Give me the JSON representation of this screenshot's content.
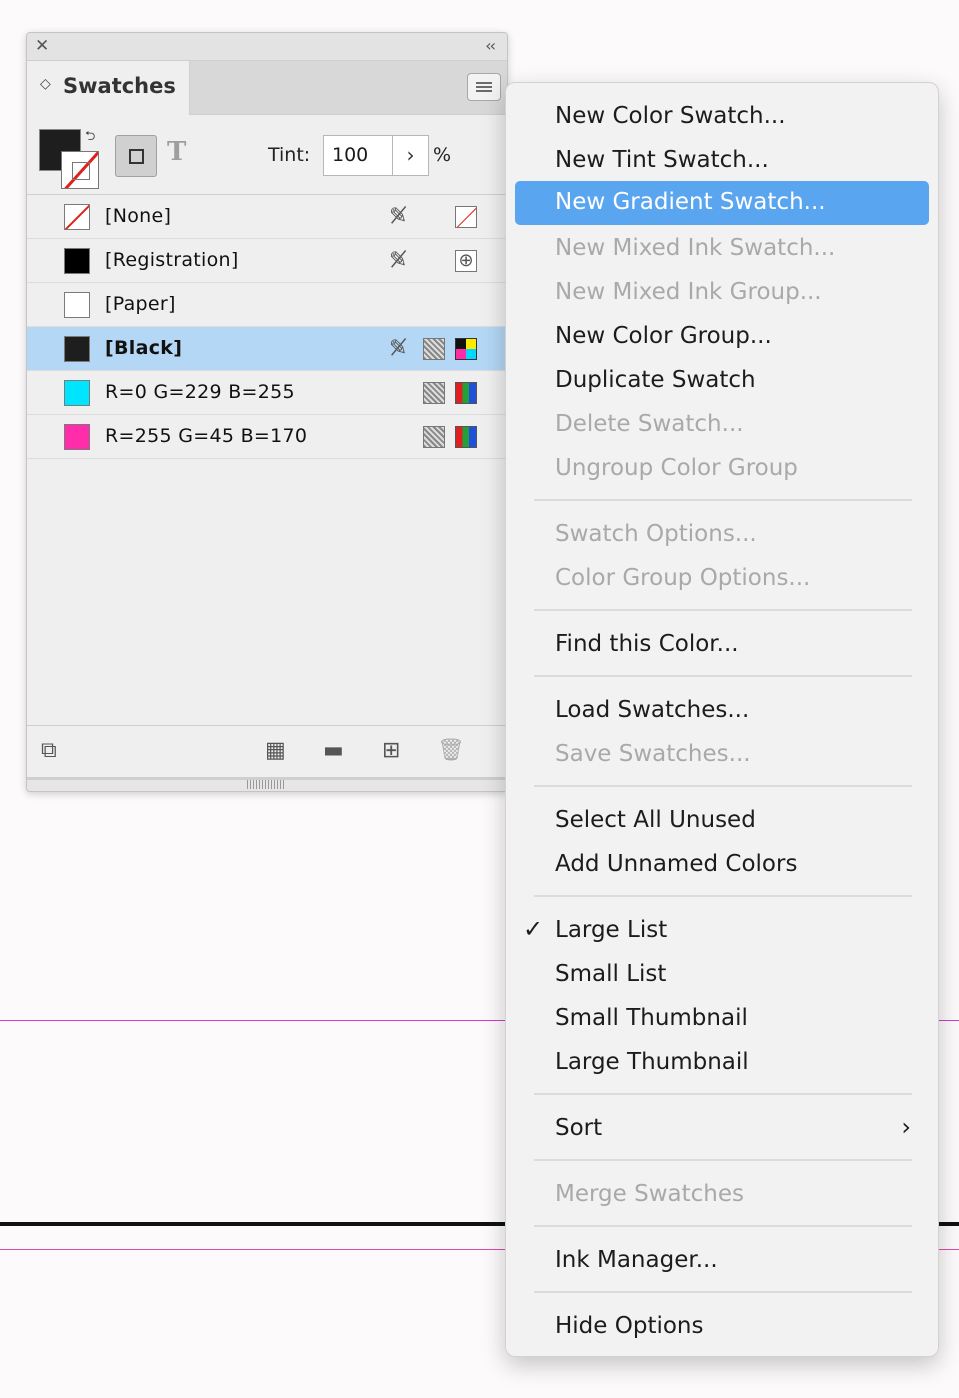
{
  "panel": {
    "title": "Swatches",
    "tint_label": "Tint:",
    "tint_value": "100",
    "tint_unit": "%",
    "swatches": [
      {
        "name": "[None]",
        "color": "none",
        "selected": false
      },
      {
        "name": "[Registration]",
        "color": "#000000",
        "selected": false
      },
      {
        "name": "[Paper]",
        "color": "#ffffff",
        "selected": false
      },
      {
        "name": "[Black]",
        "color": "#1e1e1e",
        "selected": true
      },
      {
        "name": "R=0 G=229 B=255",
        "color": "#00e5ff",
        "selected": false
      },
      {
        "name": "R=255 G=45 B=170",
        "color": "#ff2daa",
        "selected": false
      }
    ],
    "icons": {
      "close": "close-icon",
      "collapse": "collapse-icon",
      "panel_menu": "hamburger-icon",
      "bottom": [
        "import-icon",
        "show-kinds-icon",
        "folder-icon",
        "new-swatch-icon",
        "trash-icon"
      ]
    }
  },
  "menu": {
    "items": [
      {
        "label": "New Color Swatch...",
        "enabled": true
      },
      {
        "label": "New Tint Swatch...",
        "enabled": true
      },
      {
        "label": "New Gradient Swatch...",
        "enabled": true,
        "highlighted": true
      },
      {
        "label": "New Mixed Ink Swatch...",
        "enabled": false
      },
      {
        "label": "New Mixed Ink Group...",
        "enabled": false
      },
      {
        "label": "New Color Group...",
        "enabled": true
      },
      {
        "label": "Duplicate Swatch",
        "enabled": true
      },
      {
        "label": "Delete Swatch...",
        "enabled": false
      },
      {
        "label": "Ungroup Color Group",
        "enabled": false
      },
      {
        "label": "Swatch Options...",
        "enabled": false
      },
      {
        "label": "Color Group Options...",
        "enabled": false
      },
      {
        "label": "Find this Color...",
        "enabled": true
      },
      {
        "label": "Load Swatches...",
        "enabled": true
      },
      {
        "label": "Save Swatches...",
        "enabled": false
      },
      {
        "label": "Select All Unused",
        "enabled": true
      },
      {
        "label": "Add Unnamed Colors",
        "enabled": true
      },
      {
        "label": "Large List",
        "enabled": true,
        "checked": true
      },
      {
        "label": "Small List",
        "enabled": true
      },
      {
        "label": "Small Thumbnail",
        "enabled": true
      },
      {
        "label": "Large Thumbnail",
        "enabled": true
      },
      {
        "label": "Sort",
        "enabled": true,
        "submenu": true
      },
      {
        "label": "Merge Swatches",
        "enabled": false
      },
      {
        "label": "Ink Manager...",
        "enabled": true
      },
      {
        "label": "Hide Options",
        "enabled": true
      }
    ],
    "highlight_color": "#5aa5ef"
  }
}
